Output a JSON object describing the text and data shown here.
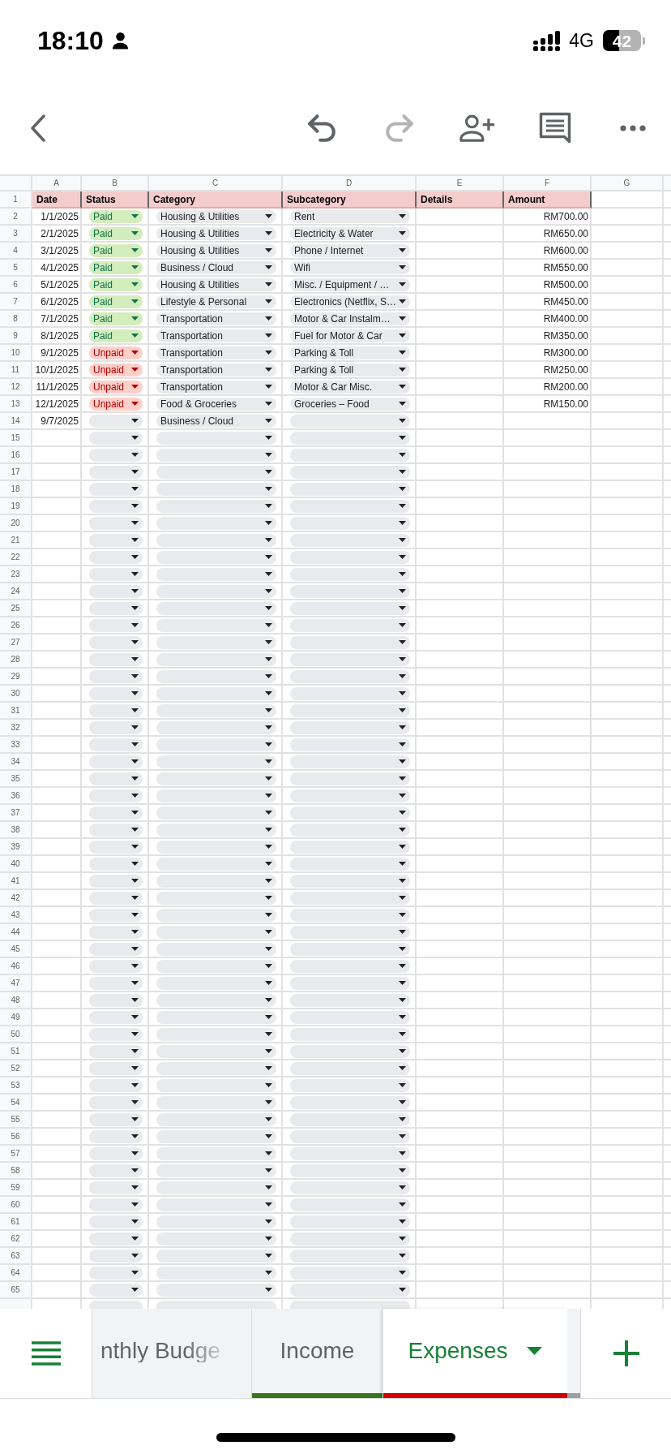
{
  "status_bar": {
    "time": "18:10",
    "network": "4G",
    "battery": "42"
  },
  "toolbar": {
    "undo": {
      "disabled": false
    },
    "redo": {
      "disabled": true
    }
  },
  "sheet": {
    "columns": [
      {
        "letter": "A",
        "header": "Date"
      },
      {
        "letter": "B",
        "header": "Status",
        "dropdown": true
      },
      {
        "letter": "C",
        "header": "Category",
        "dropdown": true
      },
      {
        "letter": "D",
        "header": "Subcategory",
        "dropdown": true
      },
      {
        "letter": "E",
        "header": "Details"
      },
      {
        "letter": "F",
        "header": "Amount"
      },
      {
        "letter": "G"
      }
    ],
    "header_row_number": "1",
    "rows": [
      {
        "number": "2",
        "date": "1/1/2025",
        "status": {
          "text": "Paid",
          "kind": "paid"
        },
        "category": "Housing & Utilities",
        "subcategory": "Rent",
        "amount": "RM700.00"
      },
      {
        "number": "3",
        "date": "2/1/2025",
        "status": {
          "text": "Paid",
          "kind": "paid"
        },
        "category": "Housing & Utilities",
        "subcategory": "Electricity & Water",
        "amount": "RM650.00"
      },
      {
        "number": "4",
        "date": "3/1/2025",
        "status": {
          "text": "Paid",
          "kind": "paid"
        },
        "category": "Housing & Utilities",
        "subcategory": "Phone / Internet",
        "amount": "RM600.00"
      },
      {
        "number": "5",
        "date": "4/1/2025",
        "status": {
          "text": "Paid",
          "kind": "paid"
        },
        "category": "Business / Cloud",
        "subcategory": "Wifi",
        "amount": "RM550.00"
      },
      {
        "number": "6",
        "date": "5/1/2025",
        "status": {
          "text": "Paid",
          "kind": "paid"
        },
        "category": "Housing & Utilities",
        "subcategory": "Misc. / Equipment / …",
        "amount": "RM500.00"
      },
      {
        "number": "7",
        "date": "6/1/2025",
        "status": {
          "text": "Paid",
          "kind": "paid"
        },
        "category": "Lifestyle & Personal",
        "subcategory": "Electronics (Netflix, S…",
        "amount": "RM450.00"
      },
      {
        "number": "8",
        "date": "7/1/2025",
        "status": {
          "text": "Paid",
          "kind": "paid"
        },
        "category": "Transportation",
        "subcategory": "Motor & Car Instalm…",
        "amount": "RM400.00"
      },
      {
        "number": "9",
        "date": "8/1/2025",
        "status": {
          "text": "Paid",
          "kind": "paid"
        },
        "category": "Transportation",
        "subcategory": "Fuel for Motor & Car",
        "amount": "RM350.00"
      },
      {
        "number": "10",
        "date": "9/1/2025",
        "status": {
          "text": "Unpaid",
          "kind": "unpaid"
        },
        "category": "Transportation",
        "subcategory": "Parking & Toll",
        "amount": "RM300.00"
      },
      {
        "number": "11",
        "date": "10/1/2025",
        "status": {
          "text": "Unpaid",
          "kind": "unpaid"
        },
        "category": "Transportation",
        "subcategory": "Parking & Toll",
        "amount": "RM250.00"
      },
      {
        "number": "12",
        "date": "11/1/2025",
        "status": {
          "text": "Unpaid",
          "kind": "unpaid"
        },
        "category": "Transportation",
        "subcategory": "Motor & Car Misc.",
        "amount": "RM200.00"
      },
      {
        "number": "13",
        "date": "12/1/2025",
        "status": {
          "text": "Unpaid",
          "kind": "unpaid"
        },
        "category": "Food & Groceries",
        "subcategory": "Groceries – Food",
        "amount": "RM150.00"
      },
      {
        "number": "14",
        "date": "9/7/2025",
        "category": "Business / Cloud"
      },
      {
        "number": "15"
      },
      {
        "number": "16"
      },
      {
        "number": "17"
      },
      {
        "number": "18"
      },
      {
        "number": "19"
      },
      {
        "number": "20"
      },
      {
        "number": "21"
      },
      {
        "number": "22"
      },
      {
        "number": "23"
      },
      {
        "number": "24"
      },
      {
        "number": "25"
      },
      {
        "number": "26"
      },
      {
        "number": "27"
      },
      {
        "number": "28"
      },
      {
        "number": "29"
      },
      {
        "number": "30"
      },
      {
        "number": "31"
      },
      {
        "number": "32"
      },
      {
        "number": "33"
      },
      {
        "number": "34"
      },
      {
        "number": "35"
      },
      {
        "number": "36"
      },
      {
        "number": "37"
      },
      {
        "number": "38"
      },
      {
        "number": "39"
      },
      {
        "number": "40"
      },
      {
        "number": "41"
      },
      {
        "number": "42"
      },
      {
        "number": "43"
      },
      {
        "number": "44"
      },
      {
        "number": "45"
      },
      {
        "number": "46"
      },
      {
        "number": "47"
      },
      {
        "number": "48"
      },
      {
        "number": "49"
      },
      {
        "number": "50"
      },
      {
        "number": "51"
      },
      {
        "number": "52"
      },
      {
        "number": "53"
      },
      {
        "number": "54"
      },
      {
        "number": "55"
      },
      {
        "number": "56"
      },
      {
        "number": "57"
      },
      {
        "number": "58"
      },
      {
        "number": "59"
      },
      {
        "number": "60"
      },
      {
        "number": "61"
      },
      {
        "number": "62"
      },
      {
        "number": "63"
      },
      {
        "number": "64"
      },
      {
        "number": "65"
      }
    ]
  },
  "sheet_tabs": [
    {
      "label": "nthly Budge",
      "selected": false
    },
    {
      "label": "Income",
      "selected": false,
      "color": "#38761d"
    },
    {
      "label": "Expenses",
      "selected": true,
      "color": "#cc0000"
    }
  ]
}
